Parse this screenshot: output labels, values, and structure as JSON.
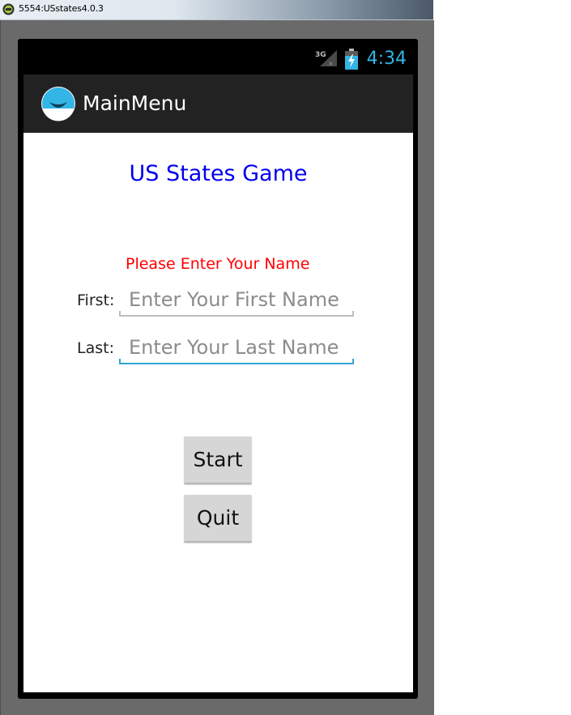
{
  "window": {
    "title": "5554:USstates4.0.3"
  },
  "status_bar": {
    "network": "3G",
    "time": "4:34",
    "clock_color": "#33b5e5"
  },
  "action_bar": {
    "title": "MainMenu",
    "app_icon": "android-app-icon"
  },
  "main": {
    "title": "US States Game",
    "title_color": "#0000ee",
    "prompt": "Please Enter Your Name",
    "prompt_color": "#ff0000",
    "first_label": "First:",
    "first_value": "",
    "first_placeholder": "Enter Your First Name",
    "last_label": "Last:",
    "last_value": "",
    "last_placeholder": "Enter Your Last Name",
    "focused_field": "last",
    "focus_color": "#33a4d4",
    "start_label": "Start",
    "quit_label": "Quit"
  }
}
